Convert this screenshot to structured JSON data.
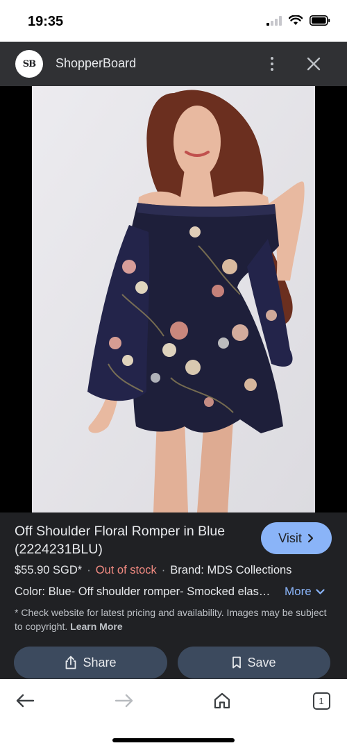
{
  "status_bar": {
    "time": "19:35"
  },
  "header": {
    "site_name": "ShopperBoard",
    "logo_text": "SB"
  },
  "product": {
    "title": "Off Shoulder Floral Romper in Blue (2224231BLU)",
    "price": "$55.90 SGD*",
    "stock_status": "Out of stock",
    "brand": "Brand: MDS Collections",
    "description": "Color: Blue- Off shoulder romper- Smocked elastic off shoulder neckline",
    "disclaimer": "* Check website for latest pricing and availability. Images may be subject to copyright.",
    "learn_more": "Learn More"
  },
  "buttons": {
    "visit": "Visit",
    "more": "More",
    "share": "Share",
    "save": "Save"
  },
  "bottom_nav": {
    "tab_count": "1"
  },
  "colors": {
    "accent": "#8ab4f8",
    "out_of_stock": "#f28b82",
    "panel_bg": "#202124",
    "button_bg": "#3c4a5e"
  }
}
